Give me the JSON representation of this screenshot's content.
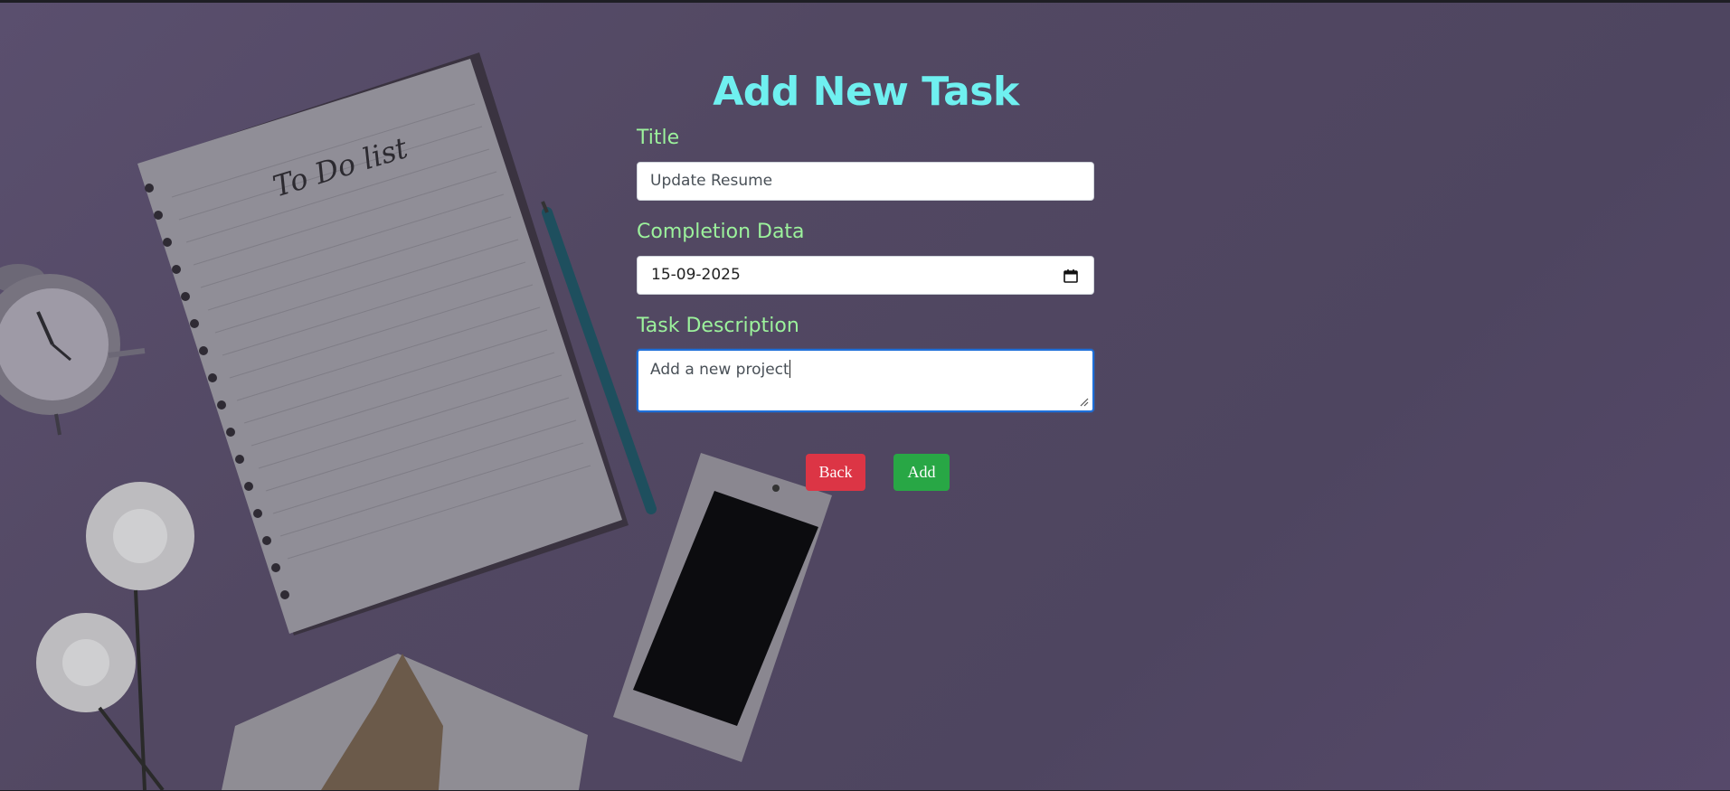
{
  "page": {
    "heading": "Add New Task"
  },
  "form": {
    "title_label": "Title",
    "title_value": "Update Resume",
    "date_label": "Completion Data",
    "date_value": "15-09-2025",
    "description_label": "Task Description",
    "description_value": "Add a new project"
  },
  "actions": {
    "back_label": "Back",
    "add_label": "Add"
  },
  "background": {
    "notebook_text": "To Do list"
  },
  "colors": {
    "heading": "#6ff0f0",
    "labels": "#9cf29c",
    "back_button": "#dc3545",
    "add_button": "#28a745",
    "focus_border": "#1e6fd9",
    "backdrop": "#524862"
  },
  "icons": [
    "calendar-icon",
    "resize-handle-icon"
  ]
}
